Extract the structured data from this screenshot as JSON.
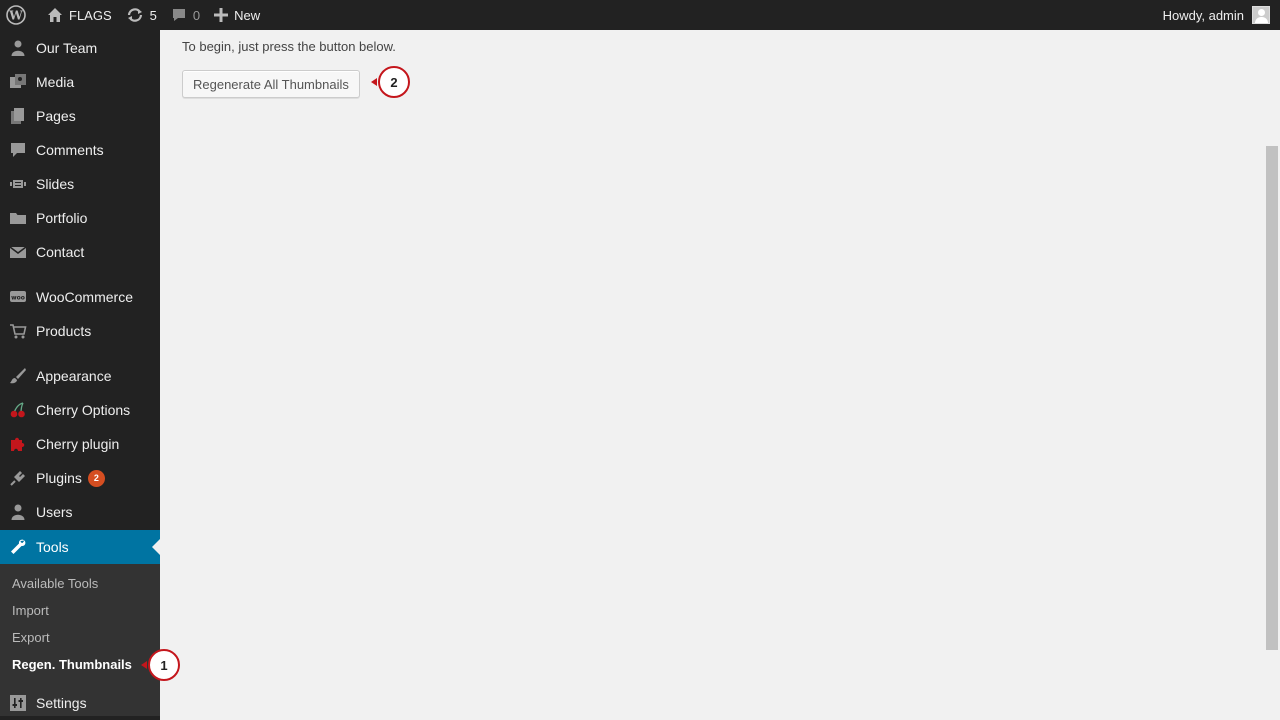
{
  "adminbar": {
    "site_name": "FLAGS",
    "updates_count": "5",
    "comments_count": "0",
    "new_label": "New",
    "howdy": "Howdy, admin"
  },
  "sidebar": {
    "items": [
      {
        "label": "Our Team",
        "icon": "person-icon"
      },
      {
        "label": "Media",
        "icon": "media-icon"
      },
      {
        "label": "Pages",
        "icon": "pages-icon"
      },
      {
        "label": "Comments",
        "icon": "comment-icon"
      },
      {
        "label": "Slides",
        "icon": "slides-icon"
      },
      {
        "label": "Portfolio",
        "icon": "folder-icon"
      },
      {
        "label": "Contact",
        "icon": "envelope-icon"
      },
      {
        "label": "WooCommerce",
        "icon": "woocommerce-icon"
      },
      {
        "label": "Products",
        "icon": "cart-icon"
      },
      {
        "label": "Appearance",
        "icon": "brush-icon"
      },
      {
        "label": "Cherry Options",
        "icon": "cherry-icon"
      },
      {
        "label": "Cherry plugin",
        "icon": "puzzle-icon"
      },
      {
        "label": "Plugins",
        "icon": "plug-icon",
        "badge": "2"
      },
      {
        "label": "Users",
        "icon": "users-icon"
      },
      {
        "label": "Tools",
        "icon": "wrench-icon"
      },
      {
        "label": "Settings",
        "icon": "settings-icon"
      }
    ],
    "submenu": [
      {
        "label": "Available Tools"
      },
      {
        "label": "Import"
      },
      {
        "label": "Export"
      },
      {
        "label": "Regen. Thumbnails"
      }
    ]
  },
  "main": {
    "intro": "To begin, just press the button below.",
    "button_label": "Regenerate All Thumbnails"
  },
  "markers": [
    "1",
    "2"
  ],
  "colors": {
    "adminbar_bg": "#222222",
    "sidebar_bg": "#222222",
    "submenu_bg": "#333333",
    "current_bg": "#0074a2",
    "badge_bg": "#d54e21",
    "marker_border": "#c4161c",
    "content_bg": "#f1f1f1"
  }
}
